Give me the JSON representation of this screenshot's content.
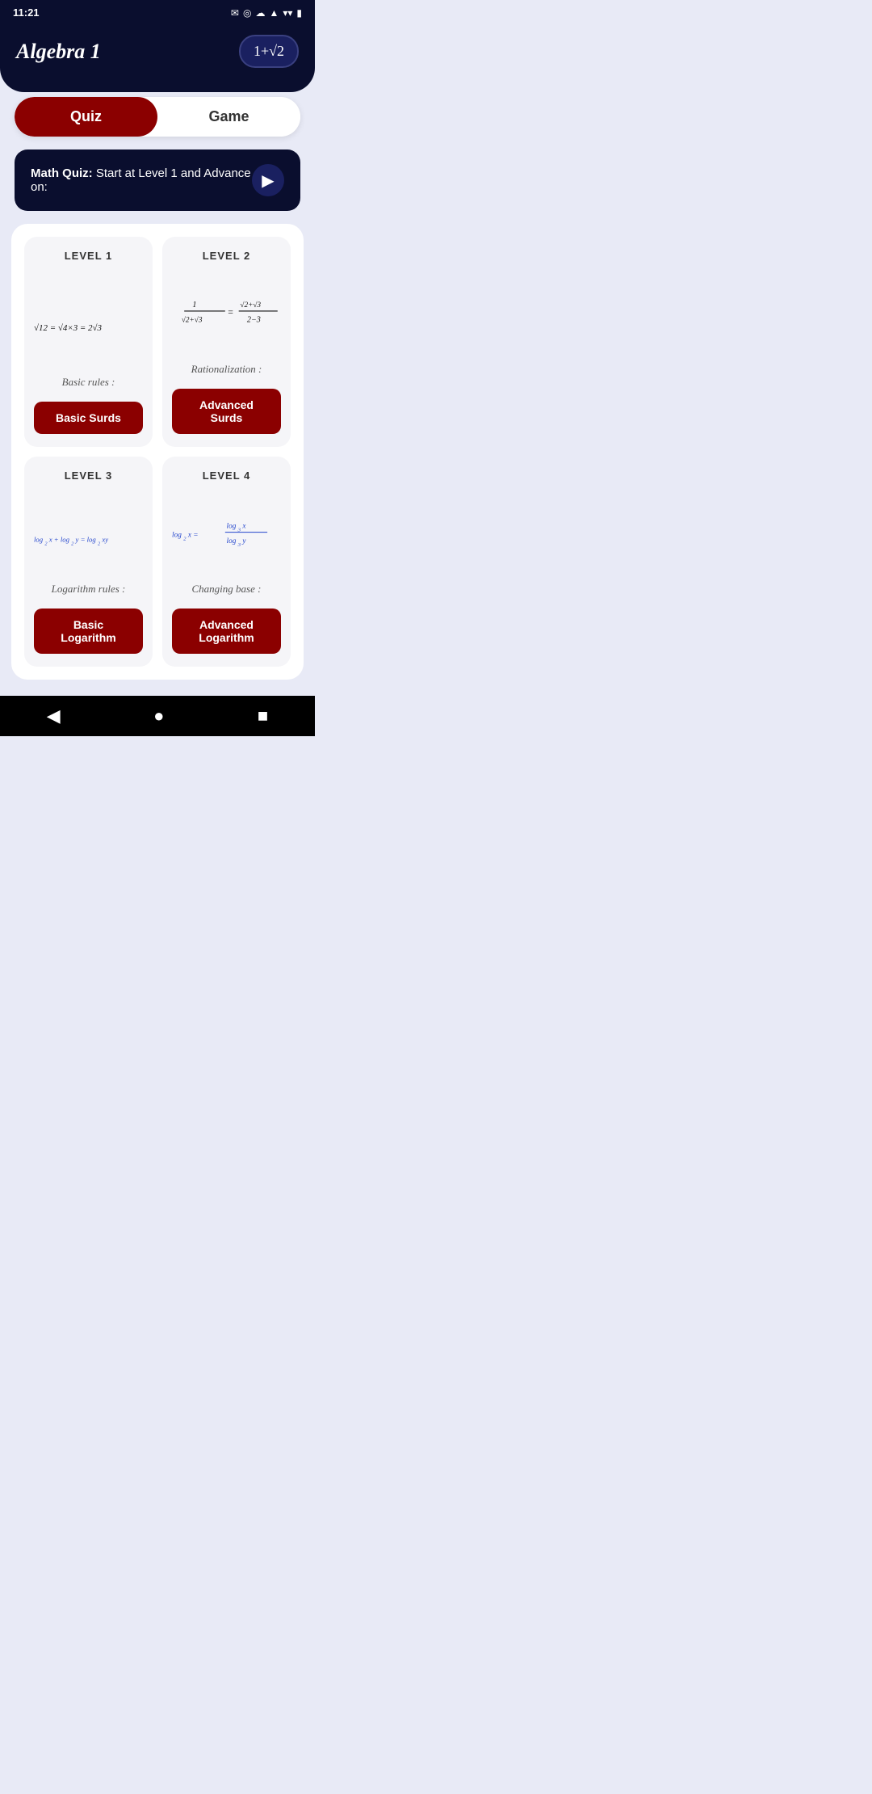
{
  "status": {
    "time": "11:21",
    "icons": [
      "✉",
      "⊙",
      "☁",
      "▲",
      "📶",
      "🔋"
    ]
  },
  "header": {
    "title": "Algebra 1",
    "badge": "1+√2"
  },
  "tabs": [
    {
      "id": "quiz",
      "label": "Quiz",
      "active": true
    },
    {
      "id": "game",
      "label": "Game",
      "active": false
    }
  ],
  "quiz_banner": {
    "prefix": "Math Quiz:",
    "text": "  Start at Level 1 and Advance on:"
  },
  "levels": [
    {
      "id": "level1",
      "label": "LEVEL 1",
      "desc": "Basic rules :",
      "button": "Basic Surds"
    },
    {
      "id": "level2",
      "label": "LEVEL 2",
      "desc": "Rationalization :",
      "button": "Advanced Surds"
    },
    {
      "id": "level3",
      "label": "LEVEL 3",
      "desc": "Logarithm rules :",
      "button": "Basic Logarithm"
    },
    {
      "id": "level4",
      "label": "LEVEL 4",
      "desc": "Changing base :",
      "button": "Advanced Logarithm"
    }
  ],
  "nav": {
    "back": "◀",
    "home": "●",
    "square": "■"
  }
}
